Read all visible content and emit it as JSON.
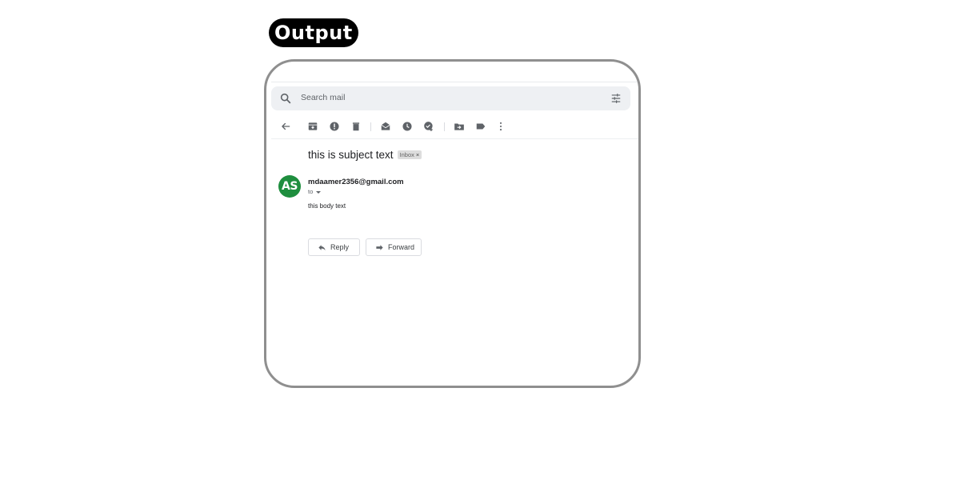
{
  "badge": {
    "label": "Output"
  },
  "search": {
    "placeholder": "Search mail"
  },
  "toolbar": {
    "icons": [
      "back-icon",
      "archive-icon",
      "report-spam-icon",
      "delete-icon",
      "mark-unread-icon",
      "snooze-icon",
      "add-to-tasks-icon",
      "move-to-icon",
      "label-icon",
      "more-options-icon"
    ]
  },
  "email": {
    "subject": "this is subject text",
    "label": "Inbox",
    "label_close": "×",
    "avatar_initials": "AS",
    "avatar_color": "#1e8e3e",
    "sender": "mdaamer2356@gmail.com",
    "to": "to",
    "body": "this body text"
  },
  "actions": {
    "reply_label": "Reply",
    "forward_label": "Forward"
  }
}
